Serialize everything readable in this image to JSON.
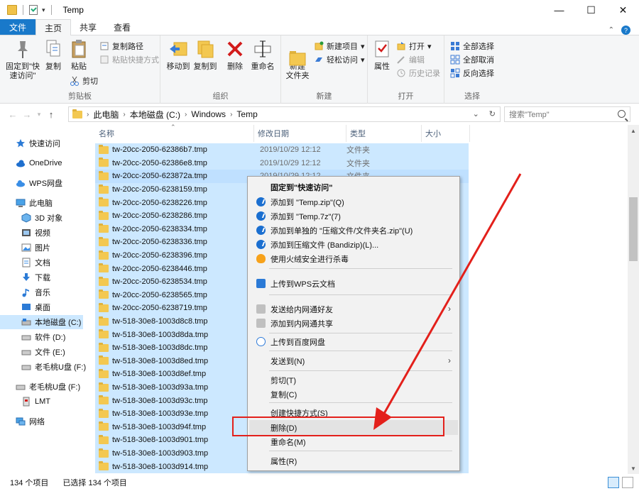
{
  "window": {
    "title": "Temp",
    "controls": {
      "minimize": "—",
      "maximize": "☐",
      "close": "✕"
    }
  },
  "ribbon_tabs": {
    "file": "文件",
    "home": "主页",
    "share": "共享",
    "view": "查看"
  },
  "ribbon": {
    "clipboard": {
      "pin": "固定到\"快速访问\"",
      "copy": "复制",
      "paste": "粘贴",
      "copy_path": "复制路径",
      "paste_shortcut": "粘贴快捷方式",
      "cut": "剪切",
      "label": "剪贴板"
    },
    "organize": {
      "move_to": "移动到",
      "copy_to": "复制到",
      "delete": "删除",
      "rename": "重命名",
      "label": "组织"
    },
    "new": {
      "new_folder": "新建\n文件夹",
      "new_item": "新建项目",
      "easy_access": "轻松访问",
      "label": "新建"
    },
    "open": {
      "properties": "属性",
      "open": "打开",
      "edit": "编辑",
      "history": "历史记录",
      "label": "打开"
    },
    "select": {
      "select_all": "全部选择",
      "select_none": "全部取消",
      "invert": "反向选择",
      "label": "选择"
    }
  },
  "address": {
    "crumbs": [
      "此电脑",
      "本地磁盘 (C:)",
      "Windows",
      "Temp"
    ],
    "search_placeholder": "搜索\"Temp\""
  },
  "nav": {
    "items": [
      {
        "label": "快速访问",
        "icon": "star-icon"
      },
      {
        "label": "OneDrive",
        "icon": "cloud-icon"
      },
      {
        "label": "WPS网盘",
        "icon": "cloud-icon"
      },
      {
        "label": "此电脑",
        "icon": "computer-icon"
      },
      {
        "label": "3D 对象",
        "icon": "cube-icon"
      },
      {
        "label": "视频",
        "icon": "video-icon"
      },
      {
        "label": "图片",
        "icon": "image-icon"
      },
      {
        "label": "文档",
        "icon": "document-icon"
      },
      {
        "label": "下载",
        "icon": "download-icon"
      },
      {
        "label": "音乐",
        "icon": "music-icon"
      },
      {
        "label": "桌面",
        "icon": "desktop-icon"
      },
      {
        "label": "本地磁盘 (C:)",
        "icon": "drive-icon"
      },
      {
        "label": "软件 (D:)",
        "icon": "drive-icon"
      },
      {
        "label": "文件 (E:)",
        "icon": "drive-icon"
      },
      {
        "label": "老毛桃U盘 (F:)",
        "icon": "usb-drive-icon"
      },
      {
        "label": "老毛桃U盘 (F:)",
        "icon": "usb-drive-icon"
      },
      {
        "label": "LMT",
        "icon": "drive-icon"
      },
      {
        "label": "网络",
        "icon": "network-icon"
      }
    ]
  },
  "columns": {
    "name": "名称",
    "date": "修改日期",
    "type": "类型",
    "size": "大小"
  },
  "files": [
    {
      "name": "tw-20cc-2050-62386b7.tmp",
      "date": "2019/10/29 12:12",
      "type": "文件夹"
    },
    {
      "name": "tw-20cc-2050-62386e8.tmp",
      "date": "2019/10/29 12:12",
      "type": "文件夹"
    },
    {
      "name": "tw-20cc-2050-623872a.tmp",
      "date": "2019/10/29 12:12",
      "type": "文件夹"
    },
    {
      "name": "tw-20cc-2050-6238159.tmp",
      "date": "",
      "type": ""
    },
    {
      "name": "tw-20cc-2050-6238226.tmp",
      "date": "",
      "type": ""
    },
    {
      "name": "tw-20cc-2050-6238286.tmp",
      "date": "",
      "type": ""
    },
    {
      "name": "tw-20cc-2050-6238334.tmp",
      "date": "",
      "type": ""
    },
    {
      "name": "tw-20cc-2050-6238336.tmp",
      "date": "",
      "type": ""
    },
    {
      "name": "tw-20cc-2050-6238396.tmp",
      "date": "",
      "type": ""
    },
    {
      "name": "tw-20cc-2050-6238446.tmp",
      "date": "",
      "type": ""
    },
    {
      "name": "tw-20cc-2050-6238534.tmp",
      "date": "",
      "type": ""
    },
    {
      "name": "tw-20cc-2050-6238565.tmp",
      "date": "",
      "type": ""
    },
    {
      "name": "tw-20cc-2050-6238719.tmp",
      "date": "",
      "type": ""
    },
    {
      "name": "tw-518-30e8-1003d8c8.tmp",
      "date": "",
      "type": ""
    },
    {
      "name": "tw-518-30e8-1003d8da.tmp",
      "date": "",
      "type": ""
    },
    {
      "name": "tw-518-30e8-1003d8dc.tmp",
      "date": "",
      "type": ""
    },
    {
      "name": "tw-518-30e8-1003d8ed.tmp",
      "date": "",
      "type": ""
    },
    {
      "name": "tw-518-30e8-1003d8ef.tmp",
      "date": "",
      "type": ""
    },
    {
      "name": "tw-518-30e8-1003d93a.tmp",
      "date": "",
      "type": ""
    },
    {
      "name": "tw-518-30e8-1003d93c.tmp",
      "date": "",
      "type": ""
    },
    {
      "name": "tw-518-30e8-1003d93e.tmp",
      "date": "",
      "type": ""
    },
    {
      "name": "tw-518-30e8-1003d94f.tmp",
      "date": "",
      "type": ""
    },
    {
      "name": "tw-518-30e8-1003d901.tmp",
      "date": "",
      "type": ""
    },
    {
      "name": "tw-518-30e8-1003d903.tmp",
      "date": "",
      "type": ""
    },
    {
      "name": "tw-518-30e8-1003d914.tmp",
      "date": "",
      "type": ""
    }
  ],
  "context_menu": {
    "items": [
      {
        "label": "固定到\"快速访问\"",
        "bold": true,
        "icon": ""
      },
      {
        "label": "添加到 \"Temp.zip\"(Q)",
        "icon": "bandizip"
      },
      {
        "label": "添加到 \"Temp.7z\"(7)",
        "icon": "bandizip"
      },
      {
        "label": "添加到单独的 \"压缩文件/文件夹名.zip\"(U)",
        "icon": "bandizip"
      },
      {
        "label": "添加到压缩文件 (Bandizip)(L)...",
        "icon": "bandizip"
      },
      {
        "label": "使用火绒安全进行杀毒",
        "icon": "fire"
      },
      {
        "label": "上传到WPS云文档",
        "icon": "wps"
      },
      {
        "label": "发送给内网通好友",
        "icon": "netsend",
        "submenu": true
      },
      {
        "label": "添加到内网通共享",
        "icon": "netsend"
      },
      {
        "label": "上传到百度网盘",
        "icon": "baidu"
      },
      {
        "label": "发送到(N)",
        "icon": "",
        "submenu": true
      },
      {
        "label": "剪切(T)",
        "icon": ""
      },
      {
        "label": "复制(C)",
        "icon": ""
      },
      {
        "label": "创建快捷方式(S)",
        "icon": ""
      },
      {
        "label": "删除(D)",
        "icon": "",
        "highlighted": true
      },
      {
        "label": "重命名(M)",
        "icon": ""
      },
      {
        "label": "属性(R)",
        "icon": ""
      }
    ]
  },
  "status": {
    "count": "134 个项目",
    "selected": "已选择 134 个项目"
  },
  "colors": {
    "accent": "#1979ca",
    "selection": "#cce8ff",
    "annotation_red": "#e3201b"
  }
}
